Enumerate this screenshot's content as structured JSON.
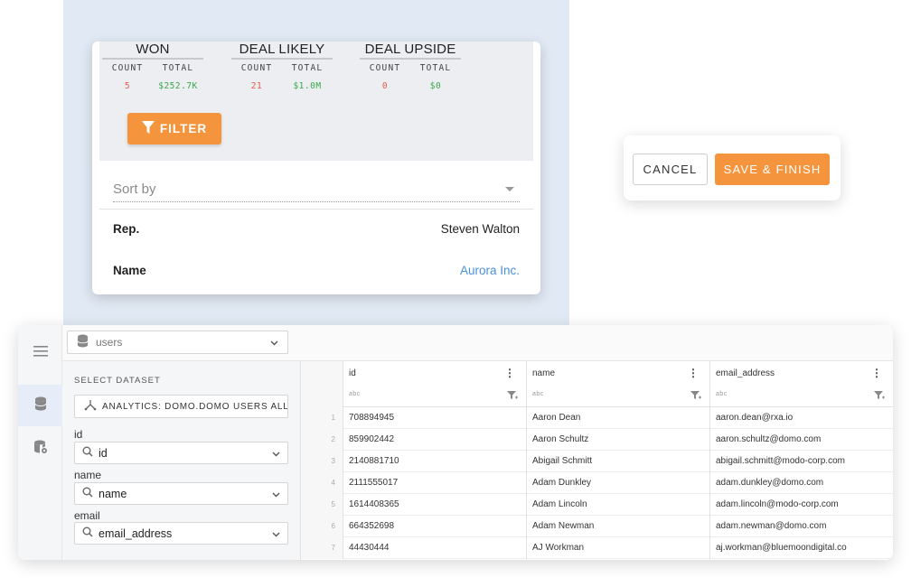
{
  "metrics": [
    {
      "title": "WON",
      "count_label": "COUNT",
      "total_label": "TOTAL",
      "count": "5",
      "total": "$252.7K"
    },
    {
      "title": "DEAL LIKELY",
      "count_label": "COUNT",
      "total_label": "TOTAL",
      "count": "21",
      "total": "$1.0M"
    },
    {
      "title": "DEAL UPSIDE",
      "count_label": "COUNT",
      "total_label": "TOTAL",
      "count": "0",
      "total": "$0"
    }
  ],
  "filter_label": "FILTER",
  "sort": {
    "placeholder": "Sort by"
  },
  "detail": {
    "rep_label": "Rep.",
    "rep_value": "Steven Walton",
    "name_label": "Name",
    "name_value": "Aurora Inc."
  },
  "actions": {
    "cancel": "CANCEL",
    "save": "SAVE & FINISH"
  },
  "app": {
    "dataset_select": "users",
    "select_dataset_title": "SELECT DATASET",
    "dataset_button": "ANALYTICS: DOMO.DOMO USERS ALL...",
    "fields": [
      {
        "label": "id",
        "value": "id"
      },
      {
        "label": "name",
        "value": "name"
      },
      {
        "label": "email",
        "value": "email_address"
      }
    ],
    "columns": [
      {
        "name": "id",
        "type": "abc"
      },
      {
        "name": "name",
        "type": "abc"
      },
      {
        "name": "email_address",
        "type": "abc"
      }
    ],
    "rows": [
      {
        "n": "1",
        "id": "708894945",
        "name": "Aaron Dean",
        "email": "aaron.dean@rxa.io"
      },
      {
        "n": "2",
        "id": "859902442",
        "name": "Aaron Schultz",
        "email": "aaron.schultz@domo.com"
      },
      {
        "n": "3",
        "id": "2140881710",
        "name": "Abigail Schmitt",
        "email": "abigail.schmitt@modo-corp.com"
      },
      {
        "n": "4",
        "id": "2111555017",
        "name": "Adam Dunkley",
        "email": "adam.dunkley@domo.com"
      },
      {
        "n": "5",
        "id": "1614408365",
        "name": "Adam Lincoln",
        "email": "adam.lincoln@modo-corp.com"
      },
      {
        "n": "6",
        "id": "664352698",
        "name": "Adam Newman",
        "email": "adam.newman@domo.com"
      },
      {
        "n": "7",
        "id": "44430444",
        "name": "AJ Workman",
        "email": "aj.workman@bluemoondigital.co"
      }
    ]
  },
  "colors": {
    "accent": "#f4953d",
    "link": "#4a90d9",
    "red": "#e35d4b",
    "green": "#39a84a"
  }
}
